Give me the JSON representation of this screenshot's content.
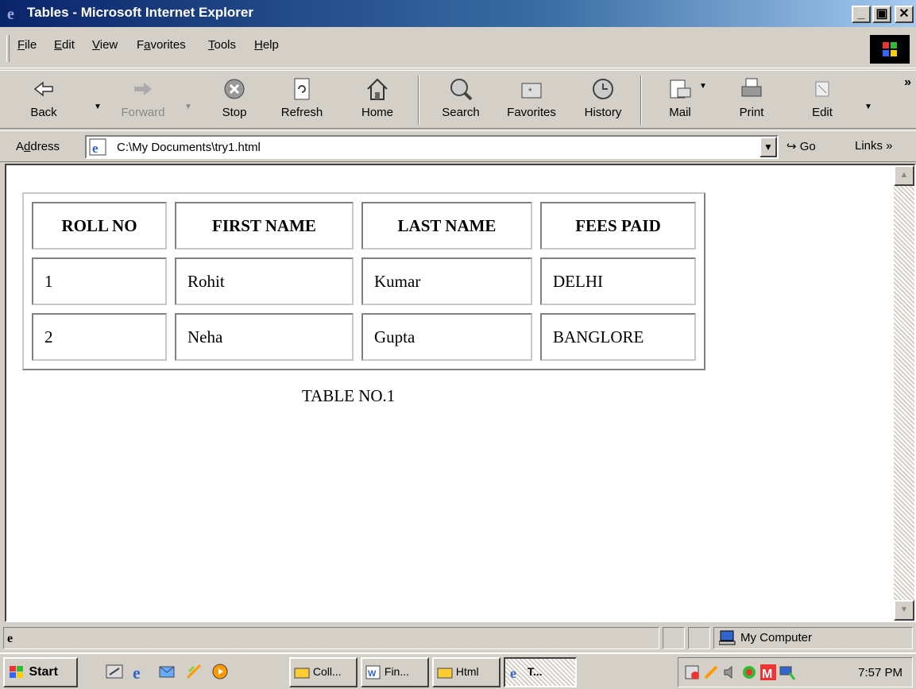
{
  "window": {
    "title": "Tables - Microsoft Internet Explorer",
    "min": "_",
    "max": "▣",
    "close": "✕"
  },
  "menu": [
    {
      "label": "File",
      "key": "F",
      "rest": "ile"
    },
    {
      "label": "Edit",
      "key": "E",
      "rest": "dit"
    },
    {
      "label": "View",
      "key": "V",
      "rest": "iew"
    },
    {
      "label": "Favorites",
      "key": "a",
      "pre": "F",
      "rest": "vorites"
    },
    {
      "label": "Tools",
      "key": "T",
      "rest": "ools"
    },
    {
      "label": "Help",
      "key": "H",
      "rest": "elp"
    }
  ],
  "toolbar": {
    "back": "Back",
    "forward": "Forward",
    "stop": "Stop",
    "refresh": "Refresh",
    "home": "Home",
    "search": "Search",
    "favorites": "Favorites",
    "history": "History",
    "mail": "Mail",
    "print": "Print",
    "edit": "Edit",
    "more": "»"
  },
  "address": {
    "label_key": "d",
    "label_pre": "A",
    "label_rest": "dress",
    "url": "C:\\My Documents\\try1.html",
    "go": "Go",
    "links": "Links »"
  },
  "table": {
    "headers": [
      "ROLL NO",
      "FIRST NAME",
      "LAST NAME",
      "FEES PAID"
    ],
    "rows": [
      [
        "1",
        "Rohit",
        "Kumar",
        "DELHI"
      ],
      [
        "2",
        "Neha",
        "Gupta",
        "BANGLORE"
      ]
    ],
    "caption": "TABLE NO.1"
  },
  "status": {
    "zone": "My Computer"
  },
  "taskbar": {
    "start": "Start",
    "tasks": [
      "Coll...",
      "Fin...",
      "Html",
      "T..."
    ],
    "clock": "7:57 PM"
  }
}
